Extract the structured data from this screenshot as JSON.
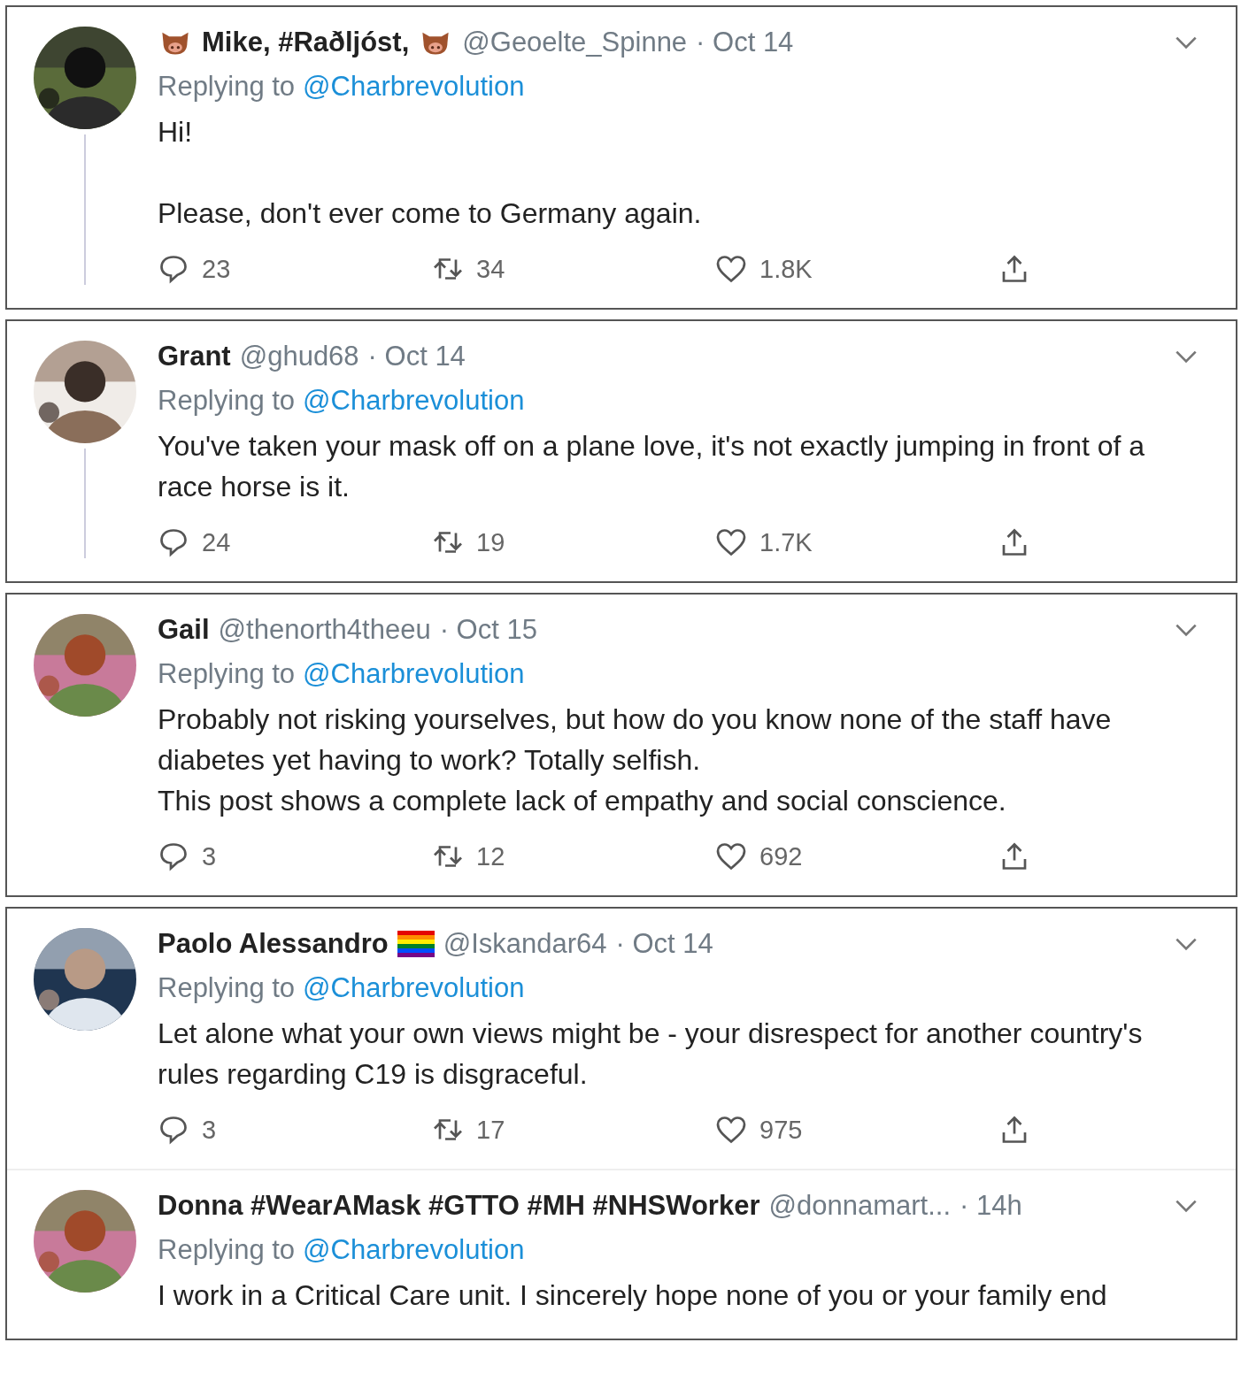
{
  "cards": [
    {
      "tweets": [
        {
          "name_parts": [
            {
              "kind": "boar"
            },
            {
              "kind": "text",
              "text": "Mike, #Raðljóst,"
            },
            {
              "kind": "boar"
            }
          ],
          "handle": "@Geoelte_Spinne",
          "date": "· Oct 14",
          "replying_label": "Replying to",
          "replying_handle": "@Charbrevolution",
          "body": "Hi!\n\nPlease, don't ever come to Germany again.",
          "replies": "23",
          "retweets": "34",
          "likes": "1.8K",
          "thread_line": true
        }
      ]
    },
    {
      "tweets": [
        {
          "name_parts": [
            {
              "kind": "text",
              "text": "Grant"
            }
          ],
          "handle": "@ghud68",
          "date": "· Oct 14",
          "replying_label": "Replying to",
          "replying_handle": "@Charbrevolution",
          "body": "You've taken your mask off on a plane love, it's not exactly jumping in front of a race horse is it.",
          "replies": "24",
          "retweets": "19",
          "likes": "1.7K",
          "thread_line": true
        }
      ]
    },
    {
      "tweets": [
        {
          "name_parts": [
            {
              "kind": "text",
              "text": "Gail"
            }
          ],
          "handle": "@thenorth4theeu",
          "date": "· Oct 15",
          "replying_label": "Replying to",
          "replying_handle": "@Charbrevolution",
          "body": "Probably not risking yourselves, but how do you know none of the staff have diabetes yet having to work? Totally selfish.\nThis post shows a complete lack of empathy and social conscience.",
          "replies": "3",
          "retweets": "12",
          "likes": "692",
          "thread_line": false
        }
      ]
    },
    {
      "tweets": [
        {
          "name_parts": [
            {
              "kind": "text",
              "text": "Paolo Alessandro"
            },
            {
              "kind": "flag"
            }
          ],
          "handle": "@Iskandar64",
          "date": "· Oct 14",
          "replying_label": "Replying to",
          "replying_handle": "@Charbrevolution",
          "body": "Let alone what your own views might be - your disrespect for another country's rules regarding C19 is disgraceful.",
          "replies": "3",
          "retweets": "17",
          "likes": "975",
          "thread_line": false
        },
        {
          "name_parts": [
            {
              "kind": "text",
              "text": "Donna #WearAMask #GTTO #MH #NHSWorker"
            }
          ],
          "handle": "@donnamart...",
          "date": "· 14h",
          "replying_label": "Replying to",
          "replying_handle": "@Charbrevolution",
          "body": "I work in a Critical Care unit. I sincerely hope none of you or your family end",
          "thread_line": false
        }
      ]
    }
  ]
}
